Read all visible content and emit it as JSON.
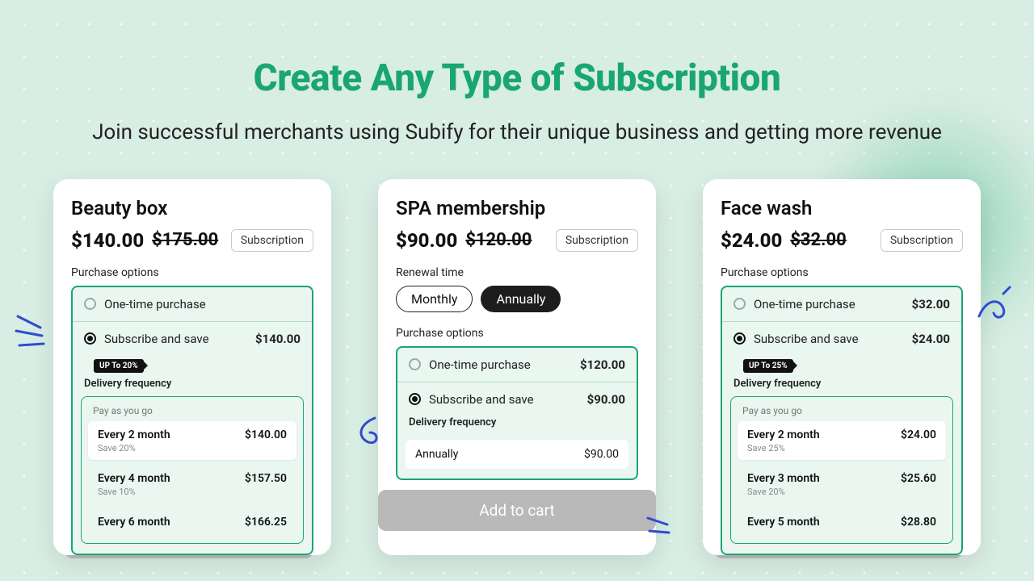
{
  "hero": {
    "title": "Create Any Type of Subscription",
    "subtitle": "Join successful merchants using Subify for their unique business and getting more revenue"
  },
  "labels": {
    "purchase_options": "Purchase options",
    "subscription_badge": "Subscription",
    "one_time": "One-time purchase",
    "subscribe_save": "Subscribe and save",
    "delivery_frequency": "Delivery frequency",
    "pay_as_you_go": "Pay as you go",
    "renewal_time": "Renewal time",
    "add_to_cart": "Add to cart"
  },
  "cards": [
    {
      "title": "Beauty box",
      "price": "$140.00",
      "old_price": "$175.00",
      "save_badge": "UP To 20%",
      "sub_price": "$140.00",
      "freq": [
        {
          "label": "Every 2 month",
          "price": "$140.00",
          "save": "Save 20%",
          "hi": true
        },
        {
          "label": "Every 4 month",
          "price": "$157.50",
          "save": "Save 10%"
        },
        {
          "label": "Every 6 month",
          "price": "$166.25",
          "save": ""
        }
      ]
    },
    {
      "title": "SPA membership",
      "price": "$90.00",
      "old_price": "$120.00",
      "renewal": {
        "monthly": "Monthly",
        "annually": "Annually"
      },
      "one_time_price": "$120.00",
      "sub_price": "$90.00",
      "annually_row": {
        "label": "Annually",
        "price": "$90.00"
      }
    },
    {
      "title": "Face wash",
      "price": "$24.00",
      "old_price": "$32.00",
      "save_badge": "UP To 25%",
      "one_time_price": "$32.00",
      "sub_price": "$24.00",
      "freq": [
        {
          "label": "Every 2 month",
          "price": "$24.00",
          "save": "Save 25%",
          "hi": true
        },
        {
          "label": "Every 3 month",
          "price": "$25.60",
          "save": "Save 20%"
        },
        {
          "label": "Every 5 month",
          "price": "$28.80",
          "save": ""
        }
      ]
    }
  ]
}
